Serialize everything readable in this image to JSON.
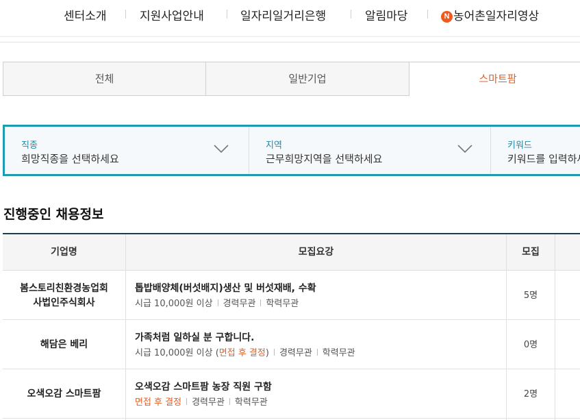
{
  "nav": {
    "items": [
      "센터소개",
      "지원사업안내",
      "일자리일거리은행",
      "알림마당"
    ],
    "special_badge": "N",
    "special_label": "농어촌일자리영상"
  },
  "tabs": [
    {
      "label": "전체",
      "active": false
    },
    {
      "label": "일반기업",
      "active": false
    },
    {
      "label": "스마트팜",
      "active": true
    }
  ],
  "filter": {
    "job": {
      "label": "직종",
      "value": "희망직종을 선택하세요"
    },
    "region": {
      "label": "지역",
      "value": "근무희망지역을 선택하세요"
    },
    "keyword": {
      "label": "키워드",
      "placeholder": "키워드를 입력하세요"
    }
  },
  "section_title": "진행중인 채용정보",
  "table": {
    "headers": [
      "기업명",
      "모집요강",
      "모집"
    ],
    "rows": [
      {
        "company_line1": "봄스토리친환경농업회",
        "company_line2": "사법인주식회사",
        "title": "톱밥배양체(버섯배지)생산 및 버섯재배, 수확",
        "wage": "시급  10,000원 이상",
        "note": "",
        "career": "경력무관",
        "education": "학력무관",
        "count": "5명"
      },
      {
        "company_line1": "해담은 베리",
        "company_line2": "",
        "title": "가족처럼 일하실 분 구합니다.",
        "wage": "시급  10,000원 이상",
        "note": "면접 후 결정",
        "career": "경력무관",
        "education": "학력무관",
        "count": "0명"
      },
      {
        "company_line1": "오색오감 스마트팜",
        "company_line2": "",
        "title": "오색오감 스마트팜 농장 직원 구함",
        "wage": "",
        "note": "면접 후 결정",
        "career": "경력무관",
        "education": "학력무관",
        "count": "2명"
      }
    ]
  },
  "colors": {
    "accent": "#e0612a",
    "filter_border": "#1e9bb0",
    "header_rule": "#1c3d4a",
    "badge": "#f05a1e"
  }
}
